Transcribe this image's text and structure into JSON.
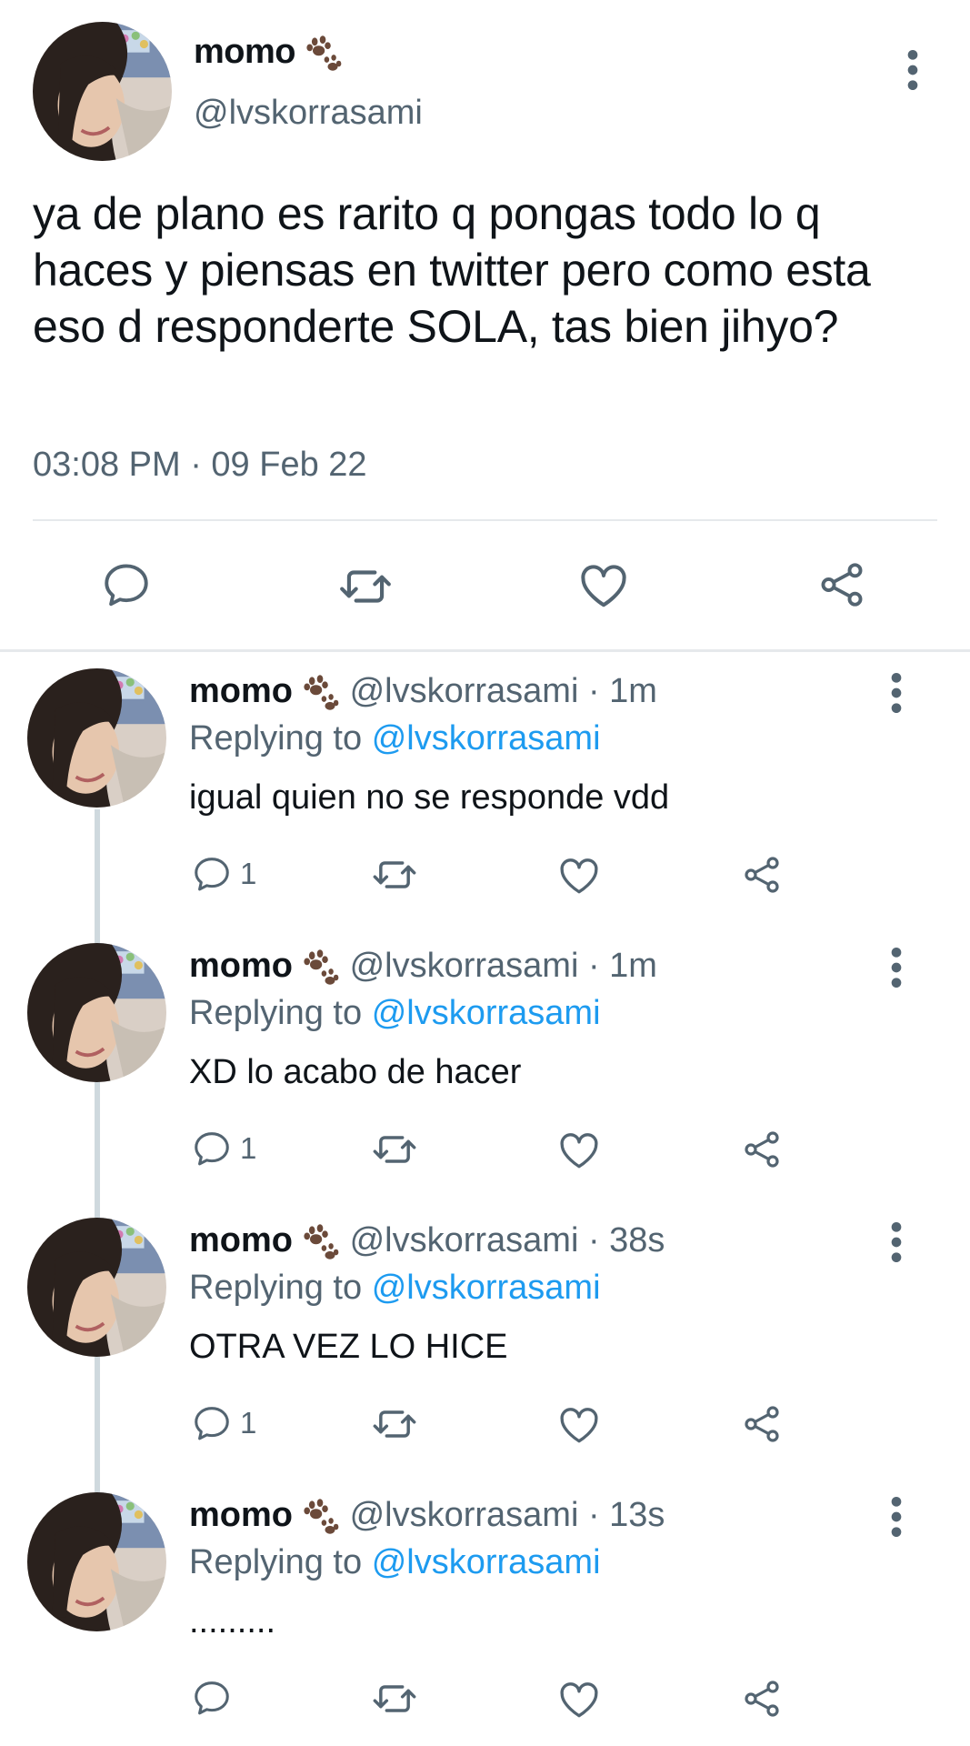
{
  "main_tweet": {
    "display_name": "momo",
    "badge_emoji": "paw-prints",
    "handle": "@lvskorrasami",
    "text": "ya de plano es rarito q pongas todo lo q haces y piensas en twitter pero como esta eso d responderte SOLA, tas bien jihyo?",
    "timestamp": "03:08 PM · 09 Feb 22",
    "actions": [
      "reply-icon",
      "retweet-icon",
      "like-icon",
      "share-icon"
    ]
  },
  "replies": [
    {
      "display_name": "momo",
      "meta": "@lvskorrasami · 1m",
      "replying_prefix": "Replying to",
      "replying_handle": "@lvskorrasami",
      "text": "igual quien no se responde vdd",
      "reply_count": "1"
    },
    {
      "display_name": "momo",
      "meta": "@lvskorrasami · 1m",
      "replying_prefix": "Replying to",
      "replying_handle": "@lvskorrasami",
      "text": "XD lo acabo de hacer",
      "reply_count": "1"
    },
    {
      "display_name": "momo",
      "meta": "@lvskorrasami · 38s",
      "replying_prefix": "Replying to",
      "replying_handle": "@lvskorrasami",
      "text": "OTRA VEZ LO HICE",
      "reply_count": "1"
    },
    {
      "display_name": "momo",
      "meta": "@lvskorrasami · 13s",
      "replying_prefix": "Replying to",
      "replying_handle": "@lvskorrasami",
      "text": ".........",
      "reply_count": ""
    }
  ],
  "colors": {
    "text_primary": "#0f1419",
    "text_secondary": "#536471",
    "link": "#1d9bf0",
    "icon": "#536471",
    "divider": "#e6e9ec"
  }
}
